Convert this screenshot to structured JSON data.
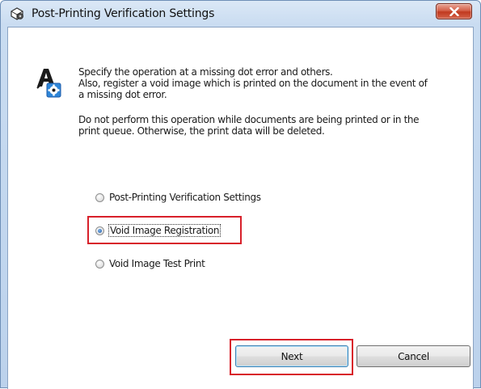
{
  "window": {
    "title": "Post-Printing Verification Settings",
    "icon": "printer-gear-icon",
    "close_icon": "close-icon"
  },
  "description": {
    "paragraph1_line1": "Specify the operation at a missing dot error and others.",
    "paragraph1_line2": "Also, register a void image which is printed on the document in the event of",
    "paragraph1_line3": "a missing dot error.",
    "paragraph2_line1": "Do not perform this operation while documents are being printed or in the",
    "paragraph2_line2": "print queue. Otherwise, the print data will be deleted."
  },
  "options": [
    {
      "label": "Post-Printing Verification Settings",
      "selected": false
    },
    {
      "label": "Void Image Registration",
      "selected": true
    },
    {
      "label": "Void Image Test Print",
      "selected": false
    }
  ],
  "buttons": {
    "next": "Next",
    "cancel": "Cancel"
  },
  "colors": {
    "highlight": "#d8202a",
    "titlebar": "#c9dcf1",
    "close_button": "#c0391f"
  }
}
